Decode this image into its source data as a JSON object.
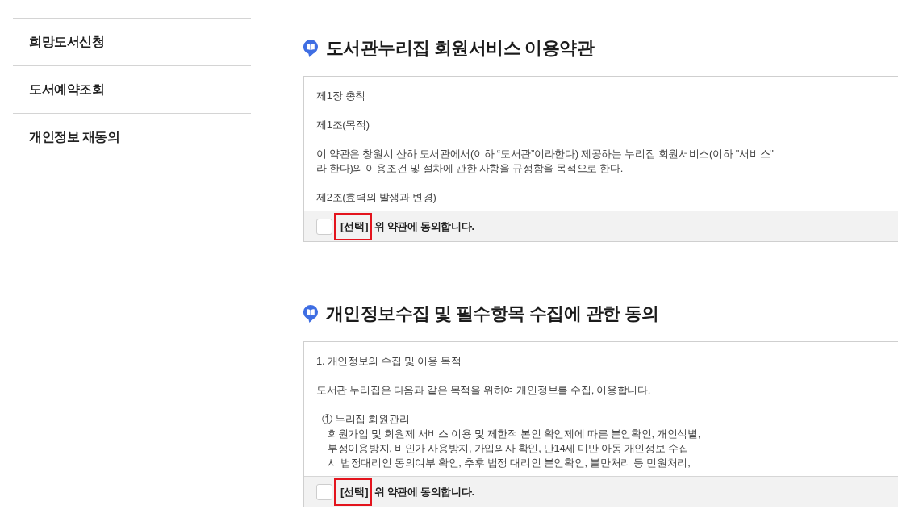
{
  "sidebar": {
    "items": [
      {
        "label": "희망도서신청"
      },
      {
        "label": "도서예약조회"
      },
      {
        "label": "개인정보 재동의"
      }
    ]
  },
  "sections": [
    {
      "title": "도서관누리집 회원서비스 이용약관",
      "terms": {
        "paragraphs": [
          {
            "kind": "text",
            "lines": [
              "제1장 총칙"
            ]
          },
          {
            "kind": "text",
            "lines": [
              "제1조(목적)"
            ]
          },
          {
            "kind": "text",
            "lines": [
              "이 약관은 창원시 산하 도서관에서(이하 “도서관”이라한다) 제공하는 누리집 회원서비스(이하 \"서비스\"",
              "라 한다)의 이용조건 및 절차에 관한 사항을 규정함을 목적으로 한다."
            ]
          },
          {
            "kind": "text",
            "lines": [
              "제2조(효력의 발생과 변경)"
            ]
          }
        ]
      },
      "agree": {
        "checked": false,
        "tag": {
          "text": "[선택]",
          "highlighted": true
        },
        "label": "위 약관에 동의합니다."
      }
    },
    {
      "title": "개인정보수집 및 필수항목 수집에 관한 동의",
      "terms": {
        "paragraphs": [
          {
            "kind": "text",
            "lines": [
              "1. 개인정보의 수집 및 이용 목적"
            ]
          },
          {
            "kind": "text",
            "lines": [
              "도서관 누리집은 다음과 같은 목적을 위하여 개인정보를 수집, 이용합니다."
            ]
          },
          {
            "kind": "list_item",
            "lines": [
              "① 누리집 회원관리",
              "회원가입 및 회원제 서비스 이용 및 제한적 본인 확인제에 따른 본인확인, 개인식별,",
              "부정이용방지, 비인가 사용방지, 가입의사 확인, 만14세 미만 아동 개인정보 수집",
              "시 법정대리인 동의여부 확인, 추후 법정 대리인 본인확인, 불만처리 등 민원처리,"
            ]
          }
        ]
      },
      "agree": {
        "checked": false,
        "tag": {
          "text": "[선택]",
          "highlighted": true
        },
        "label": "위 약관에 동의합니다."
      }
    }
  ]
}
